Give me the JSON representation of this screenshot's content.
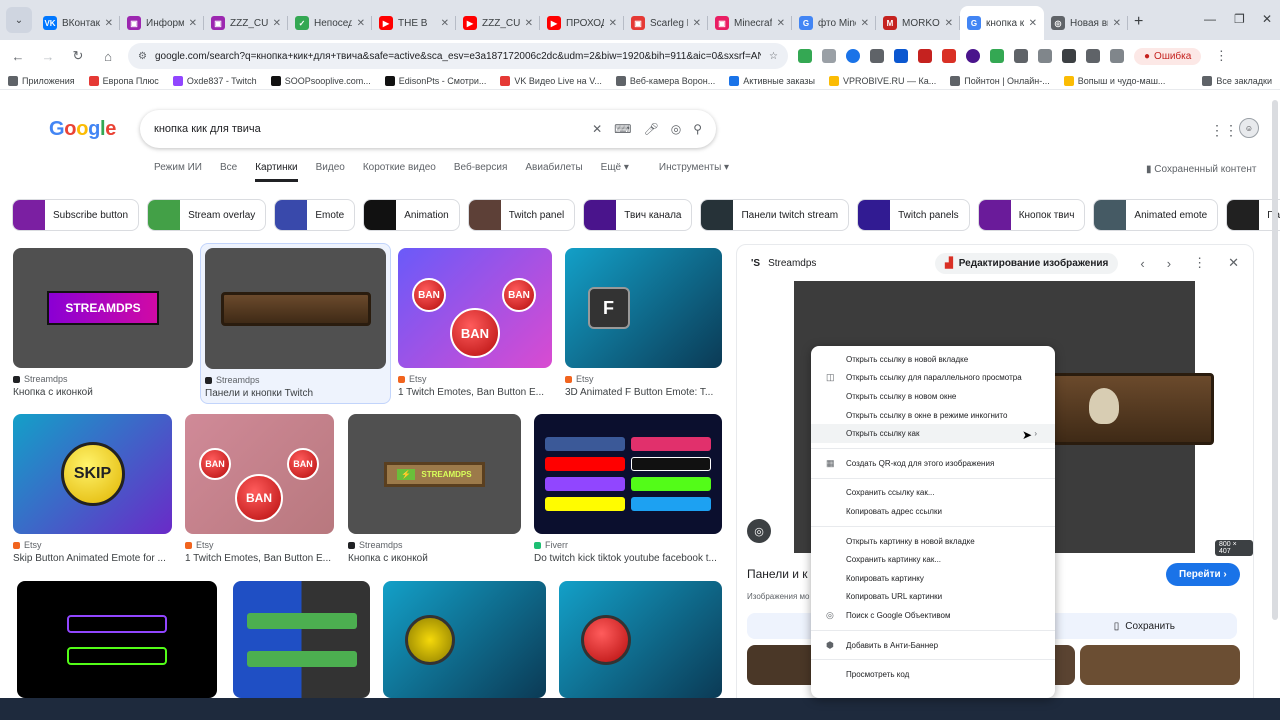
{
  "browser": {
    "tabs": [
      {
        "title": "ВКонтакте",
        "color": "#0077ff",
        "glyph": "VK"
      },
      {
        "title": "Информ",
        "color": "#9c27b0",
        "glyph": "▣"
      },
      {
        "title": "ZZZ_CUL",
        "color": "#9c27b0",
        "glyph": "▣"
      },
      {
        "title": "Непосед",
        "color": "#34a853",
        "glyph": "✓"
      },
      {
        "title": "THE B",
        "color": "#ff0000",
        "glyph": "▶"
      },
      {
        "title": "ZZZ_CUL",
        "color": "#ff0000",
        "glyph": "▶"
      },
      {
        "title": "ПРОХОДИ",
        "color": "#ff0000",
        "glyph": "▶"
      },
      {
        "title": "Scarleg Pl",
        "color": "#e53935",
        "glyph": "▣"
      },
      {
        "title": "Minecraft",
        "color": "#e91e63",
        "glyph": "▣"
      },
      {
        "title": "фто Mine",
        "color": "#4285f4",
        "glyph": "G"
      },
      {
        "title": "MORKOV",
        "color": "#c5221f",
        "glyph": "M"
      },
      {
        "title": "кнопка ки",
        "color": "#4285f4",
        "glyph": "G",
        "active": true
      },
      {
        "title": "Новая вкл",
        "color": "#5f6368",
        "glyph": "◎"
      }
    ],
    "url": "google.com/search?q=кнопка+кик+для+твича&safe=active&sca_esv=e3a187172006c2dc&udm=2&biw=1920&bih=911&aic=0&sxsrf=ANbL-n6RZ8GY...",
    "profile_label": "Ошибка",
    "bookmarks": [
      {
        "label": "Приложения",
        "color": "#5f6368"
      },
      {
        "label": "Европа Плюс",
        "color": "#e53935"
      },
      {
        "label": "Oxde837 - Twitch",
        "color": "#9146ff"
      },
      {
        "label": "SOOPsooplive.com...",
        "color": "#111111"
      },
      {
        "label": "EdisonPts - Смотри...",
        "color": "#111111"
      },
      {
        "label": "VK Видео Live на V...",
        "color": "#e53935"
      },
      {
        "label": "Веб-камера Ворон...",
        "color": "#5f6368"
      },
      {
        "label": "Активные заказы",
        "color": "#1a73e8"
      },
      {
        "label": "VPROBIVE.RU — Ка...",
        "color": "#fbbc04"
      },
      {
        "label": "Пойнтон | Онлайн-...",
        "color": "#5f6368"
      },
      {
        "label": "Вопыш и чудо-маш...",
        "color": "#fbbc04"
      }
    ],
    "all_bookmarks": "Все закладки"
  },
  "google": {
    "logo": "Google",
    "query": "кнопка кик для твича",
    "nav_tabs": [
      {
        "label": "Режим ИИ"
      },
      {
        "label": "Все"
      },
      {
        "label": "Картинки",
        "active": true
      },
      {
        "label": "Видео"
      },
      {
        "label": "Короткие видео"
      },
      {
        "label": "Веб-версия"
      },
      {
        "label": "Авиабилеты"
      },
      {
        "label": "Ещё ▾"
      },
      {
        "label": "Инструменты ▾"
      }
    ],
    "saved_content": "Сохраненный контент",
    "chips": [
      {
        "label": "Subscribe button",
        "color": "#7b1fa2"
      },
      {
        "label": "Stream overlay",
        "color": "#43a047"
      },
      {
        "label": "Emote",
        "color": "#3949ab"
      },
      {
        "label": "Animation",
        "color": "#111111"
      },
      {
        "label": "Twitch panel",
        "color": "#5d4037"
      },
      {
        "label": "Твич канала",
        "color": "#4a148c"
      },
      {
        "label": "Панели twitch stream",
        "color": "#263238"
      },
      {
        "label": "Twitch panels",
        "color": "#311b92"
      },
      {
        "label": "Кнопок твич",
        "color": "#6a1b9a"
      },
      {
        "label": "Animated emote",
        "color": "#455a64"
      },
      {
        "label": "Панели т",
        "color": "#212121"
      }
    ],
    "results": [
      {
        "source": "Streamdps",
        "title": "Кнопка с иконкой",
        "src_color": "#202124",
        "art": "STREAMDPS"
      },
      {
        "source": "Streamdps",
        "title": "Панели и кнопки Twitch",
        "src_color": "#202124",
        "art": ""
      },
      {
        "source": "Etsy",
        "title": "1 Twitch Emotes, Ban Button E...",
        "src_color": "#f1641e",
        "art": "BAN"
      },
      {
        "source": "Etsy",
        "title": "3D Animated F Button Emote: T...",
        "src_color": "#f1641e",
        "art": "F"
      },
      {
        "source": "Etsy",
        "title": "Skip Button Animated Emote for ...",
        "src_color": "#f1641e",
        "art": "SKIP"
      },
      {
        "source": "Etsy",
        "title": "1 Twitch Emotes, Ban Button E...",
        "src_color": "#f1641e",
        "art": "BAN"
      },
      {
        "source": "Streamdps",
        "title": "Кнопка с иконкой",
        "src_color": "#202124",
        "art": "STREAMDPS"
      },
      {
        "source": "Fiverr",
        "title": "Do twitch kick tiktok youtube facebook t...",
        "src_color": "#1dbf73",
        "art": ""
      }
    ]
  },
  "panel": {
    "source": "Streamdps",
    "edit_label": "Редактирование изображения",
    "size": "800 × 407",
    "title": "Панели и к",
    "subtitle": "Изображения мо",
    "visit_label": "Перейти",
    "save_label": "Сохранить"
  },
  "context_menu": {
    "items": [
      {
        "label": "Открыть ссылку в новой вкладке",
        "icon": ""
      },
      {
        "label": "Открыть ссылку для параллельного просмотра",
        "icon": "◫"
      },
      {
        "label": "Открыть ссылку в новом окне",
        "icon": ""
      },
      {
        "label": "Открыть ссылку в окне в режиме инкогнито",
        "icon": ""
      },
      {
        "label": "Открыть ссылку как",
        "icon": "",
        "arrow": "›",
        "highlight": true
      },
      {
        "sep": true
      },
      {
        "label": "Создать QR-код для этого изображения",
        "icon": "▦"
      },
      {
        "sep": true
      },
      {
        "label": "Сохранить ссылку как...",
        "icon": ""
      },
      {
        "label": "Копировать адрес ссылки",
        "icon": ""
      },
      {
        "sep": true
      },
      {
        "label": "Открыть картинку в новой вкладке",
        "icon": ""
      },
      {
        "label": "Сохранить картинку как...",
        "icon": ""
      },
      {
        "label": "Копировать картинку",
        "icon": ""
      },
      {
        "label": "Копировать URL картинки",
        "icon": ""
      },
      {
        "label": "Поиск с Google Объективом",
        "icon": "◎"
      },
      {
        "sep": true
      },
      {
        "label": "Добавить в Анти-Баннер",
        "icon": "⬢"
      },
      {
        "sep": true
      },
      {
        "label": "Просмотреть код",
        "icon": ""
      }
    ]
  }
}
